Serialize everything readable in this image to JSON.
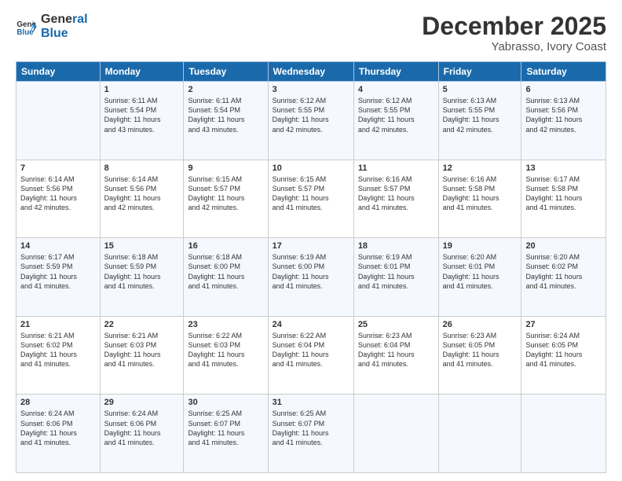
{
  "logo": {
    "line1": "General",
    "line2": "Blue"
  },
  "title": "December 2025",
  "subtitle": "Yabrasso, Ivory Coast",
  "days_header": [
    "Sunday",
    "Monday",
    "Tuesday",
    "Wednesday",
    "Thursday",
    "Friday",
    "Saturday"
  ],
  "weeks": [
    [
      {
        "day": "",
        "info": ""
      },
      {
        "day": "1",
        "info": "Sunrise: 6:11 AM\nSunset: 5:54 PM\nDaylight: 11 hours\nand 43 minutes."
      },
      {
        "day": "2",
        "info": "Sunrise: 6:11 AM\nSunset: 5:54 PM\nDaylight: 11 hours\nand 43 minutes."
      },
      {
        "day": "3",
        "info": "Sunrise: 6:12 AM\nSunset: 5:55 PM\nDaylight: 11 hours\nand 42 minutes."
      },
      {
        "day": "4",
        "info": "Sunrise: 6:12 AM\nSunset: 5:55 PM\nDaylight: 11 hours\nand 42 minutes."
      },
      {
        "day": "5",
        "info": "Sunrise: 6:13 AM\nSunset: 5:55 PM\nDaylight: 11 hours\nand 42 minutes."
      },
      {
        "day": "6",
        "info": "Sunrise: 6:13 AM\nSunset: 5:56 PM\nDaylight: 11 hours\nand 42 minutes."
      }
    ],
    [
      {
        "day": "7",
        "info": "Sunrise: 6:14 AM\nSunset: 5:56 PM\nDaylight: 11 hours\nand 42 minutes."
      },
      {
        "day": "8",
        "info": "Sunrise: 6:14 AM\nSunset: 5:56 PM\nDaylight: 11 hours\nand 42 minutes."
      },
      {
        "day": "9",
        "info": "Sunrise: 6:15 AM\nSunset: 5:57 PM\nDaylight: 11 hours\nand 42 minutes."
      },
      {
        "day": "10",
        "info": "Sunrise: 6:15 AM\nSunset: 5:57 PM\nDaylight: 11 hours\nand 41 minutes."
      },
      {
        "day": "11",
        "info": "Sunrise: 6:16 AM\nSunset: 5:57 PM\nDaylight: 11 hours\nand 41 minutes."
      },
      {
        "day": "12",
        "info": "Sunrise: 6:16 AM\nSunset: 5:58 PM\nDaylight: 11 hours\nand 41 minutes."
      },
      {
        "day": "13",
        "info": "Sunrise: 6:17 AM\nSunset: 5:58 PM\nDaylight: 11 hours\nand 41 minutes."
      }
    ],
    [
      {
        "day": "14",
        "info": "Sunrise: 6:17 AM\nSunset: 5:59 PM\nDaylight: 11 hours\nand 41 minutes."
      },
      {
        "day": "15",
        "info": "Sunrise: 6:18 AM\nSunset: 5:59 PM\nDaylight: 11 hours\nand 41 minutes."
      },
      {
        "day": "16",
        "info": "Sunrise: 6:18 AM\nSunset: 6:00 PM\nDaylight: 11 hours\nand 41 minutes."
      },
      {
        "day": "17",
        "info": "Sunrise: 6:19 AM\nSunset: 6:00 PM\nDaylight: 11 hours\nand 41 minutes."
      },
      {
        "day": "18",
        "info": "Sunrise: 6:19 AM\nSunset: 6:01 PM\nDaylight: 11 hours\nand 41 minutes."
      },
      {
        "day": "19",
        "info": "Sunrise: 6:20 AM\nSunset: 6:01 PM\nDaylight: 11 hours\nand 41 minutes."
      },
      {
        "day": "20",
        "info": "Sunrise: 6:20 AM\nSunset: 6:02 PM\nDaylight: 11 hours\nand 41 minutes."
      }
    ],
    [
      {
        "day": "21",
        "info": "Sunrise: 6:21 AM\nSunset: 6:02 PM\nDaylight: 11 hours\nand 41 minutes."
      },
      {
        "day": "22",
        "info": "Sunrise: 6:21 AM\nSunset: 6:03 PM\nDaylight: 11 hours\nand 41 minutes."
      },
      {
        "day": "23",
        "info": "Sunrise: 6:22 AM\nSunset: 6:03 PM\nDaylight: 11 hours\nand 41 minutes."
      },
      {
        "day": "24",
        "info": "Sunrise: 6:22 AM\nSunset: 6:04 PM\nDaylight: 11 hours\nand 41 minutes."
      },
      {
        "day": "25",
        "info": "Sunrise: 6:23 AM\nSunset: 6:04 PM\nDaylight: 11 hours\nand 41 minutes."
      },
      {
        "day": "26",
        "info": "Sunrise: 6:23 AM\nSunset: 6:05 PM\nDaylight: 11 hours\nand 41 minutes."
      },
      {
        "day": "27",
        "info": "Sunrise: 6:24 AM\nSunset: 6:05 PM\nDaylight: 11 hours\nand 41 minutes."
      }
    ],
    [
      {
        "day": "28",
        "info": "Sunrise: 6:24 AM\nSunset: 6:06 PM\nDaylight: 11 hours\nand 41 minutes."
      },
      {
        "day": "29",
        "info": "Sunrise: 6:24 AM\nSunset: 6:06 PM\nDaylight: 11 hours\nand 41 minutes."
      },
      {
        "day": "30",
        "info": "Sunrise: 6:25 AM\nSunset: 6:07 PM\nDaylight: 11 hours\nand 41 minutes."
      },
      {
        "day": "31",
        "info": "Sunrise: 6:25 AM\nSunset: 6:07 PM\nDaylight: 11 hours\nand 41 minutes."
      },
      {
        "day": "",
        "info": ""
      },
      {
        "day": "",
        "info": ""
      },
      {
        "day": "",
        "info": ""
      }
    ]
  ]
}
